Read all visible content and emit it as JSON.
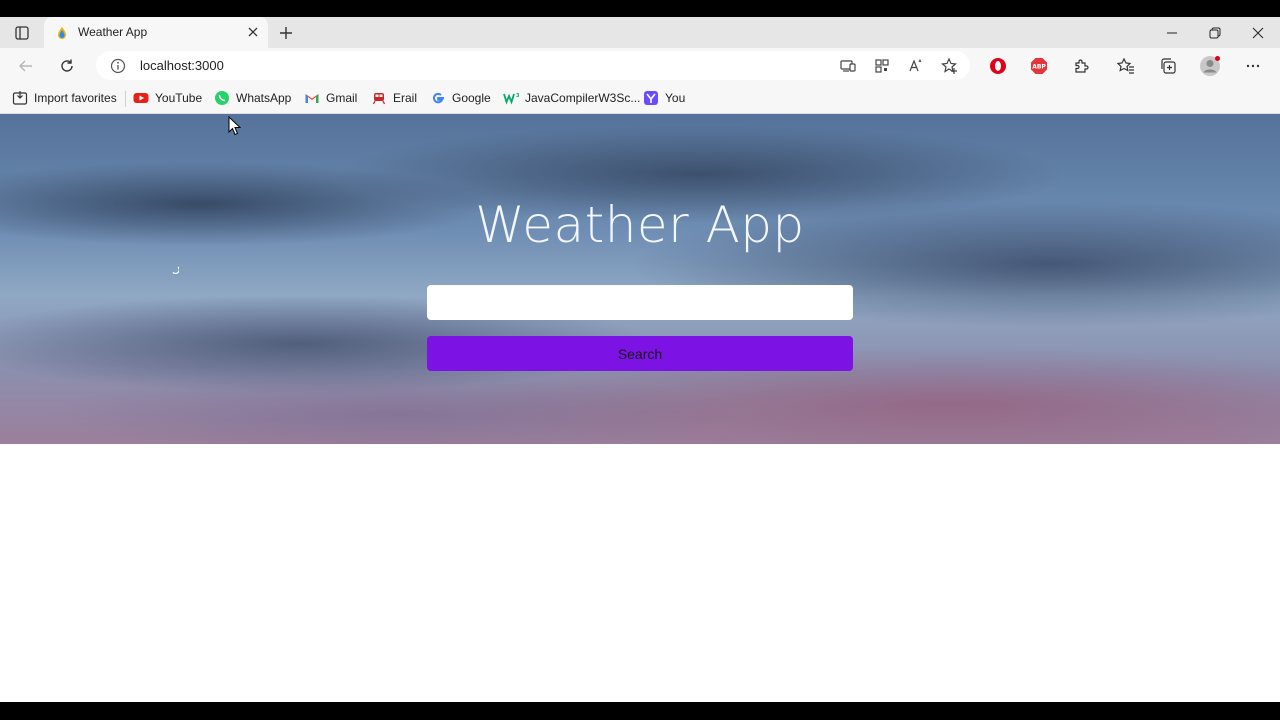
{
  "browser": {
    "tab": {
      "title": "Weather App"
    },
    "address_bar": {
      "url": "localhost:3000"
    },
    "bookmarks": [
      {
        "label": "Import favorites",
        "icon": "import-icon"
      },
      {
        "label": "YouTube",
        "icon": "youtube-icon",
        "color": "#e62117"
      },
      {
        "label": "WhatsApp",
        "icon": "whatsapp-icon",
        "color": "#25d366"
      },
      {
        "label": "Gmail",
        "icon": "gmail-icon",
        "color": "#ea4335"
      },
      {
        "label": "Erail",
        "icon": "erail-icon",
        "color": "#c62828"
      },
      {
        "label": "Google",
        "icon": "google-icon",
        "color": "#4285f4"
      },
      {
        "label": "JavaCompilerW3Sc...",
        "icon": "w3schools-icon",
        "color": "#04aa6d"
      },
      {
        "label": "You",
        "icon": "you-icon",
        "color": "#6a4cff"
      }
    ]
  },
  "page": {
    "title": "Weather App",
    "search_input": {
      "value": "",
      "placeholder": ""
    },
    "search_button": {
      "label": "Search"
    }
  },
  "colors": {
    "search_button": "#7c12e3"
  }
}
